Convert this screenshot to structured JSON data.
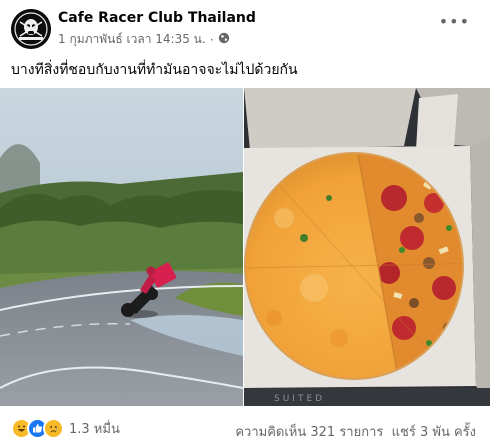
{
  "post": {
    "page_name": "Cafe Racer Club Thailand",
    "timestamp": "1 กุมภาพันธ์ เวลา 14:35 น.",
    "separator": "·",
    "privacy_icon": "globe-icon",
    "more_icon": "more-options-icon",
    "more_label": "•••",
    "caption": "บางทีสิ่งที่ชอบกับงานที่ทำมันอาจจะไม่ไปด้วยกัน"
  },
  "photos": [
    {
      "subject": "motorcyclist-leaning-into-curve"
    },
    {
      "subject": "half-pepperoni-half-cheese-pizza-in-box",
      "watermark": "SUITED"
    }
  ],
  "footer": {
    "reactions": [
      "haha",
      "like",
      "sad"
    ],
    "reaction_count": "1.3 หมื่น",
    "comments": "ความคิดเห็น 321 รายการ",
    "shares": "แชร์ 3 พัน ครั้ง"
  },
  "colors": {
    "text_primary": "#050505",
    "text_secondary": "#65676b",
    "like_blue": "#1877f2",
    "haha_yellow": "#f7b928"
  }
}
